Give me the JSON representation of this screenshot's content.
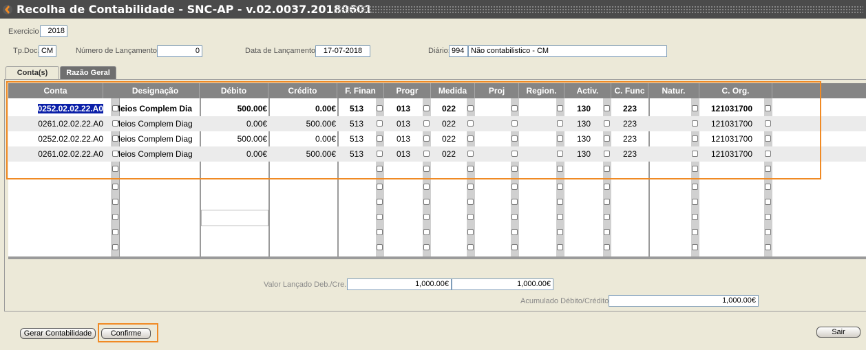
{
  "window": {
    "title": "Recolha de Contabilidade - SNC-AP - v.02.0037.20180601"
  },
  "header": {
    "exercicio_label": "Exercicio",
    "exercicio_value": "2018",
    "tpdoc_label": "Tp.Doc.",
    "tpdoc_value": "CM",
    "num_lanc_label": "Número de Lançamento:",
    "num_lanc_value": "0",
    "data_lanc_label": "Data de Lançamento:",
    "data_lanc_value": "17-07-2018",
    "diario_label": "Diário:",
    "diario_code": "994",
    "diario_desc": "Não contabilistico - CM"
  },
  "tabs": [
    {
      "label": "Conta(s)",
      "active": false
    },
    {
      "label": "Razão Geral",
      "active": true
    }
  ],
  "grid": {
    "columns": [
      "Conta",
      "Designação",
      "Débito",
      "Crédito",
      "F. Finan",
      "Progr",
      "Medida",
      "Proj",
      "Region.",
      "Activ.",
      "C. Func",
      "Natur.",
      "C. Org."
    ],
    "rows": [
      {
        "conta": "0252.02.02.22.A0",
        "designacao": "Meios Complem Dia",
        "debito": "500.00€",
        "credito": "0.00€",
        "ffinan": "513",
        "progr": "013",
        "medida": "022",
        "proj": "",
        "region": "",
        "activ": "130",
        "cfunc": "223",
        "natur": "",
        "corg": "121031700"
      },
      {
        "conta": "0261.02.02.22.A0",
        "designacao": "Meios Complem Diag",
        "debito": "0.00€",
        "credito": "500.00€",
        "ffinan": "513",
        "progr": "013",
        "medida": "022",
        "proj": "",
        "region": "",
        "activ": "130",
        "cfunc": "223",
        "natur": "",
        "corg": "121031700"
      },
      {
        "conta": "0252.02.02.22.A0",
        "designacao": "Meios Complem Diag",
        "debito": "500.00€",
        "credito": "0.00€",
        "ffinan": "513",
        "progr": "013",
        "medida": "022",
        "proj": "",
        "region": "",
        "activ": "130",
        "cfunc": "223",
        "natur": "",
        "corg": "121031700"
      },
      {
        "conta": "0261.02.02.22.A0",
        "designacao": "Meios Complem Diag",
        "debito": "0.00€",
        "credito": "500.00€",
        "ffinan": "513",
        "progr": "013",
        "medida": "022",
        "proj": "",
        "region": "",
        "activ": "130",
        "cfunc": "223",
        "natur": "",
        "corg": "121031700"
      }
    ]
  },
  "totals": {
    "valor_label": "Valor Lançado Deb./Cre.",
    "valor_deb": "1,000.00€",
    "valor_cre": "1,000.00€",
    "acum_label": "Acumulado Débito/Crédito:",
    "acum_value": "1,000.00€"
  },
  "buttons": {
    "gerar": "Gerar Contabilidade",
    "confirme": "Confirme",
    "sair": "Sair"
  },
  "colors": {
    "highlight": "#f08a24",
    "selection": "#0a1fa8",
    "header_bg": "#858585"
  }
}
